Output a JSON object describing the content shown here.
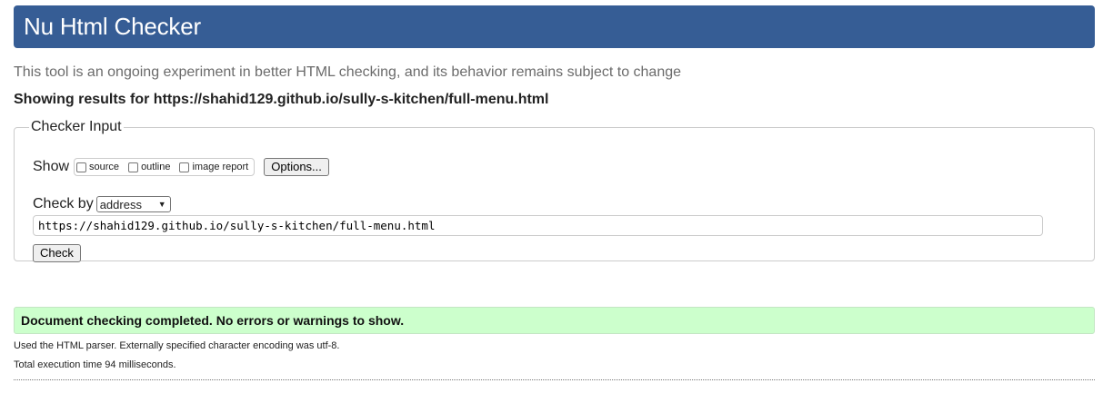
{
  "header": {
    "title": "Nu Html Checker"
  },
  "intro_text": "This tool is an ongoing experiment in better HTML checking, and its behavior remains subject to change",
  "results_heading": "Showing results for https://shahid129.github.io/sully-s-kitchen/full-menu.html",
  "checker_input": {
    "legend": "Checker Input",
    "show_label": "Show",
    "show_options": [
      "source",
      "outline",
      "image report"
    ],
    "options_button": "Options...",
    "check_by_label": "Check by",
    "check_by_selected": "address",
    "url_value": "https://shahid129.github.io/sully-s-kitchen/full-menu.html",
    "check_button": "Check"
  },
  "result": {
    "message": "Document checking completed. No errors or warnings to show.",
    "parser_info": "Used the HTML parser. Externally specified character encoding was utf-8.",
    "execution_time": "Total execution time 94 milliseconds."
  },
  "colors": {
    "title_bar": "#365d95",
    "success_bg": "#ccffcc",
    "intro_text": "#6b6b6b"
  }
}
